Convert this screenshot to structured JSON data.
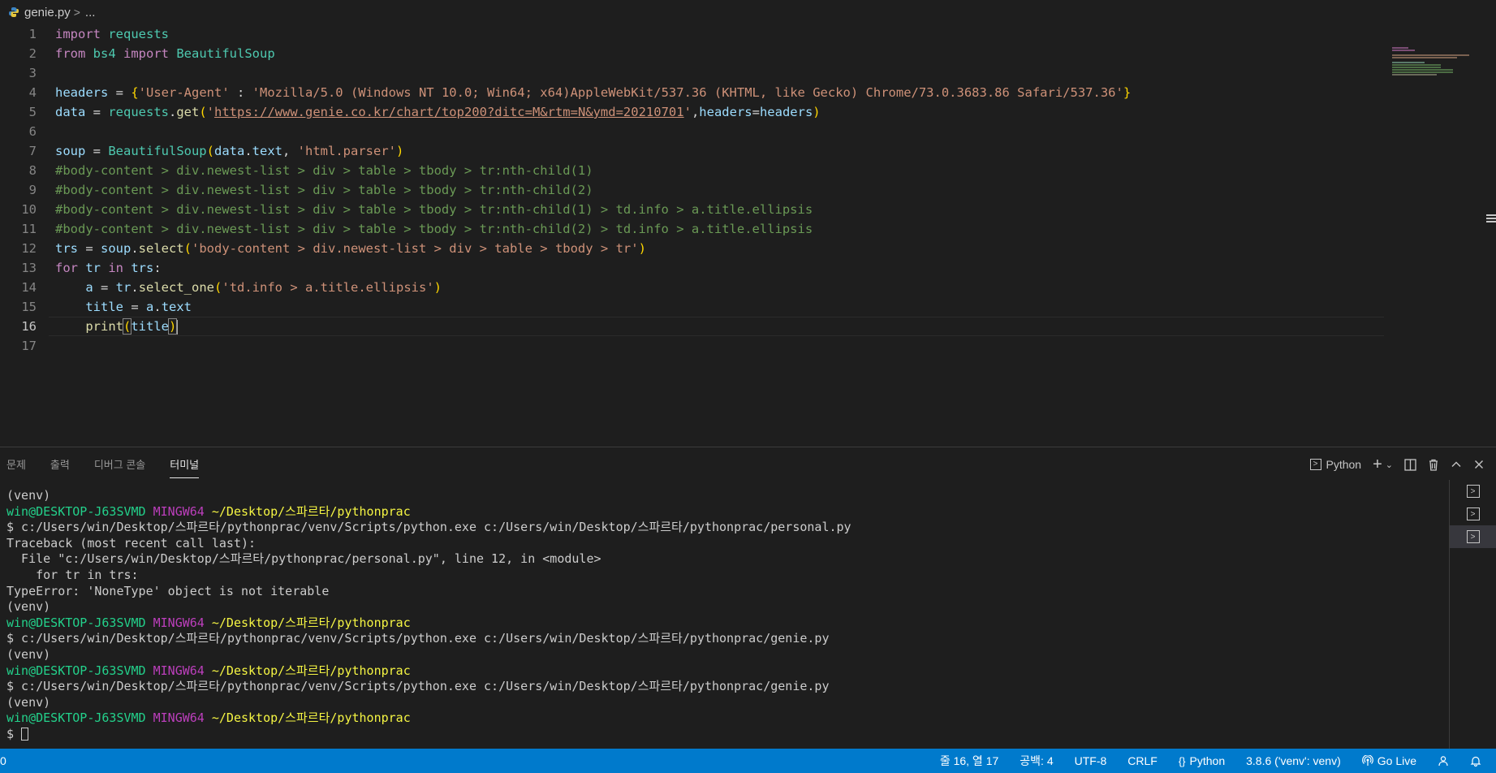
{
  "breadcrumb": {
    "file": "genie.py",
    "sep": ">",
    "more": "..."
  },
  "editor": {
    "line_numbers": [
      "1",
      "2",
      "3",
      "4",
      "5",
      "6",
      "7",
      "8",
      "9",
      "10",
      "11",
      "12",
      "13",
      "14",
      "15",
      "16",
      "17"
    ],
    "active_line": "16",
    "code": {
      "l1": {
        "kw": "import",
        "mod": " requests"
      },
      "l2": {
        "kw1": "from",
        "mod": " bs4 ",
        "kw2": "import",
        "cls": " BeautifulSoup"
      },
      "l4": {
        "var": "headers",
        "eq": " = ",
        "open": "{",
        "key": "'User-Agent'",
        "colon": " : ",
        "val": "'Mozilla/5.0 (Windows NT 10.0; Win64; x64)AppleWebKit/537.36 (KHTML, like Gecko) Chrome/73.0.3683.86 Safari/537.36'",
        "close": "}"
      },
      "l5": {
        "var": "data",
        "eq": " = ",
        "obj": "requests",
        "dot": ".",
        "fn": "get",
        "open": "(",
        "q1": "'",
        "url": "https://www.genie.co.kr/chart/top200?ditc=M&rtm=N&ymd=20210701",
        "q2": "'",
        "comma": ",",
        "kwarg": "headers",
        "eq2": "=",
        "val": "headers",
        "close": ")"
      },
      "l7": {
        "var": "soup",
        "eq": " = ",
        "cls": "BeautifulSoup",
        "open": "(",
        "arg": "data",
        "dot": ".",
        "attr": "text",
        "comma": ", ",
        "str": "'html.parser'",
        "close": ")"
      },
      "l8": "#body-content > div.newest-list > div > table > tbody > tr:nth-child(1)",
      "l9": "#body-content > div.newest-list > div > table > tbody > tr:nth-child(2)",
      "l10": "#body-content > div.newest-list > div > table > tbody > tr:nth-child(1) > td.info > a.title.ellipsis",
      "l11": "#body-content > div.newest-list > div > table > tbody > tr:nth-child(2) > td.info > a.title.ellipsis",
      "l12": {
        "var": "trs",
        "eq": " = ",
        "obj": "soup",
        "dot": ".",
        "fn": "select",
        "open": "(",
        "str": "'body-content > div.newest-list > div > table > tbody > tr'",
        "close": ")"
      },
      "l13": {
        "kw1": "for",
        "v1": " tr ",
        "kw2": "in",
        "v2": " trs",
        "colon": ":"
      },
      "l14": {
        "indent": "    ",
        "var": "a",
        "eq": " = ",
        "obj": "tr",
        "dot": ".",
        "fn": "select_one",
        "open": "(",
        "str": "'td.info > a.title.ellipsis'",
        "close": ")"
      },
      "l15": {
        "indent": "    ",
        "var": "title",
        "eq": " = ",
        "obj": "a",
        "dot": ".",
        "attr": "text"
      },
      "l16": {
        "indent": "    ",
        "fn": "print",
        "open": "(",
        "arg": "title",
        "close": ")"
      }
    }
  },
  "panel": {
    "tabs": [
      "문제",
      "출력",
      "디버그 콘솔",
      "터미널"
    ],
    "active_tab": "터미널",
    "terminal_select": "Python",
    "terminal_lines": {
      "l1": "(venv)",
      "p1_user": "win@DESKTOP-J63SVMD",
      "p1_sys": "MINGW64",
      "p1_path": "~/Desktop/스파르타/pythonprac",
      "l3": "$ c:/Users/win/Desktop/스파르타/pythonprac/venv/Scripts/python.exe c:/Users/win/Desktop/스파르타/pythonprac/personal.py",
      "l4": "Traceback (most recent call last):",
      "l5": "  File \"c:/Users/win/Desktop/스파르타/pythonprac/personal.py\", line 12, in <module>",
      "l6": "    for tr in trs:",
      "l7": "TypeError: 'NoneType' object is not iterable",
      "l8": "(venv)",
      "p2_user": "win@DESKTOP-J63SVMD",
      "p2_sys": "MINGW64",
      "p2_path": "~/Desktop/스파르타/pythonprac",
      "l10": "$ c:/Users/win/Desktop/스파르타/pythonprac/venv/Scripts/python.exe c:/Users/win/Desktop/스파르타/pythonprac/genie.py",
      "l11": "(venv)",
      "p3_user": "win@DESKTOP-J63SVMD",
      "p3_sys": "MINGW64",
      "p3_path": "~/Desktop/스파르타/pythonprac",
      "l13": "$ c:/Users/win/Desktop/스파르타/pythonprac/venv/Scripts/python.exe c:/Users/win/Desktop/스파르타/pythonprac/genie.py",
      "l14": "(venv)",
      "p4_user": "win@DESKTOP-J63SVMD",
      "p4_sys": "MINGW64",
      "p4_path": "~/Desktop/스파르타/pythonprac",
      "prompt": "$ "
    }
  },
  "statusbar": {
    "left_fragment": "0",
    "position": "줄 16, 열 17",
    "spaces": "공백: 4",
    "encoding": "UTF-8",
    "eol": "CRLF",
    "language": "Python",
    "interpreter": "3.8.6 ('venv': venv)",
    "go_live": "Go Live"
  },
  "colors": {
    "statusbar_bg": "#007acc",
    "editor_bg": "#1e1e1e",
    "keyword": "#c586c0",
    "string": "#ce9178",
    "comment": "#6a9955"
  }
}
